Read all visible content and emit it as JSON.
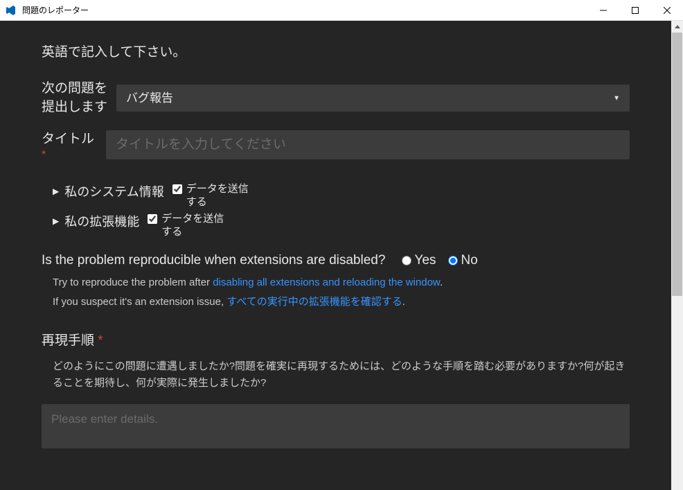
{
  "window": {
    "title": "問題のレポーター"
  },
  "instruction": "英語で記入して下さい。",
  "issueType": {
    "label": "次の問題を提出します",
    "selected": "バグ報告"
  },
  "titleField": {
    "label": "タイトル",
    "placeholder": "タイトルを入力してください"
  },
  "systemInfo": {
    "label": "私のシステム情報",
    "checkboxLabel": "データを送信する",
    "checked": true
  },
  "extensions": {
    "label": "私の拡張機能",
    "checkboxLabel": "データを送信する",
    "checked": true
  },
  "reproduce": {
    "question": "Is the problem reproducible when extensions are disabled?",
    "yes": "Yes",
    "no": "No",
    "selected": "no",
    "hint1_prefix": "Try to reproduce the problem after ",
    "hint1_link": "disabling all extensions and reloading the window",
    "hint1_suffix": ".",
    "hint2_prefix": "If you suspect it's an extension issue, ",
    "hint2_link": "すべての実行中の拡張機能を確認する",
    "hint2_suffix": "."
  },
  "steps": {
    "title": "再現手順",
    "description": "どのようにこの問題に遭遇しましたか?問題を確実に再現するためには、どのような手順を踏む必要がありますか?何が起きることを期待し、何が実際に発生しましたか?",
    "placeholder": "Please enter details."
  }
}
